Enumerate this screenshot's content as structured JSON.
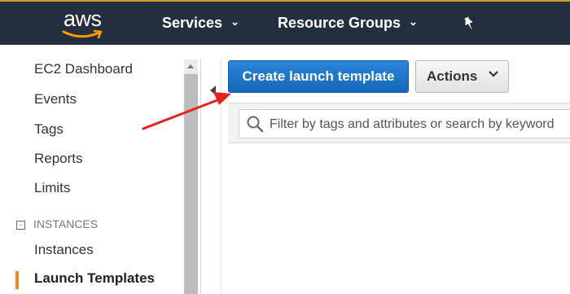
{
  "header": {
    "logo_text": "aws",
    "nav": [
      {
        "label": "Services"
      },
      {
        "label": "Resource Groups"
      }
    ],
    "background": "#232f3e"
  },
  "sidebar": {
    "items": [
      {
        "label": "EC2 Dashboard"
      },
      {
        "label": "Events"
      },
      {
        "label": "Tags"
      },
      {
        "label": "Reports"
      },
      {
        "label": "Limits"
      }
    ],
    "section": {
      "label": "INSTANCES",
      "collapse_symbol": "−"
    },
    "section_items": [
      {
        "label": "Instances"
      },
      {
        "label": "Launch Templates",
        "active": true
      }
    ],
    "active_color": "#f08a1a"
  },
  "toolbar": {
    "create_label": "Create launch template",
    "actions_label": "Actions"
  },
  "filter": {
    "placeholder": "Filter by tags and attributes or search by keyword"
  },
  "colors": {
    "primary_button": "#1f7bd0",
    "annotation_arrow": "#e8201f"
  },
  "icons": [
    "chevron-down-icon",
    "pin-icon",
    "search-icon",
    "collapse-icon",
    "scroll-up-icon",
    "annotation-arrow"
  ]
}
